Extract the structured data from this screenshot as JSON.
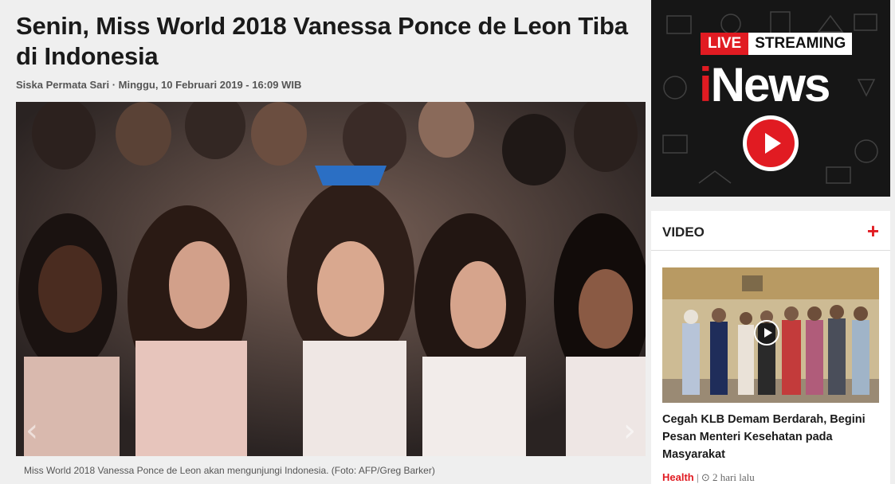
{
  "article": {
    "title": "Senin, Miss World 2018 Vanessa Ponce de Leon Tiba di Indonesia",
    "byline": "Siska Permata Sari · Minggu, 10 Februari 2019 - 16:09 WIB",
    "photo_caption": "Miss World 2018 Vanessa Ponce de Leon akan mengunjungi Indonesia. (Foto: AFP/Greg Barker)",
    "prev_arrow": "‹",
    "next_arrow": "›"
  },
  "live_banner": {
    "live_label": "LIVE",
    "streaming_label": "STREAMING",
    "brand_i": "i",
    "brand_rest": "News"
  },
  "video_panel": {
    "heading": "VIDEO",
    "more_symbol": "+",
    "headline": "Cegah KLB Demam Berdarah, Begini Pesan Menteri Kesehatan pada Masyarakat",
    "category": "Health",
    "separator": "|",
    "time_icon": "⊙",
    "time": "2 hari lalu"
  },
  "colors": {
    "accent": "#e11b22",
    "page_bg": "#efefef",
    "panel_bg": "#ffffff",
    "live_bg": "#161616"
  },
  "icons": [
    "chevron-left-icon",
    "chevron-right-icon",
    "play-icon",
    "plus-icon",
    "clock-icon"
  ]
}
